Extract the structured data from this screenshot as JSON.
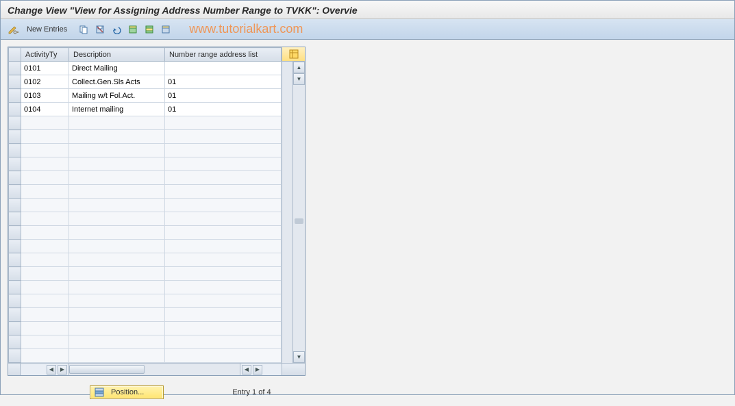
{
  "title": "Change View \"View for Assigning Address Number Range to TVKK\": Overvie",
  "toolbar": {
    "new_entries": "New Entries"
  },
  "watermark": "www.tutorialkart.com",
  "grid": {
    "columns": {
      "activity": "ActivityTy",
      "description": "Description",
      "number_range": "Number range address list"
    },
    "rows": [
      {
        "activity": "0101",
        "description": "Direct Mailing",
        "number_range": ""
      },
      {
        "activity": "0102",
        "description": "Collect.Gen.Sls Acts",
        "number_range": "01"
      },
      {
        "activity": "0103",
        "description": "Mailing w/t Fol.Act.",
        "number_range": "01"
      },
      {
        "activity": "0104",
        "description": "Internet mailing",
        "number_range": "01"
      }
    ],
    "empty_row_count": 18
  },
  "footer": {
    "position_label": "Position...",
    "entry_status": "Entry 1 of 4"
  },
  "icons": {
    "pencil": "pencil-glasses-icon",
    "copy": "copy-icon",
    "save": "save-variant-icon",
    "undo": "undo-icon",
    "row1": "select-all-icon",
    "row2": "select-block-icon",
    "row3": "deselect-all-icon",
    "corner": "table-settings-icon",
    "position": "position-icon"
  }
}
